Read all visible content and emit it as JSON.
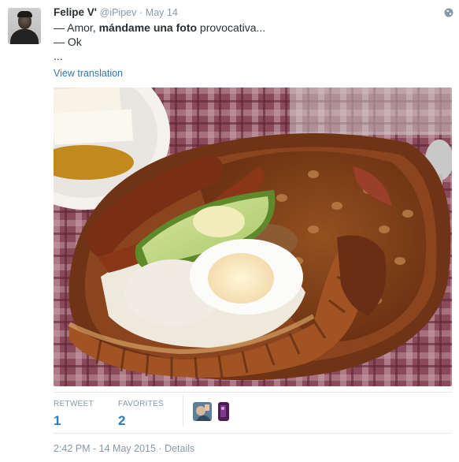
{
  "tweet": {
    "fullname": "Felipe V'",
    "handle": "@iPipev",
    "separator": "·",
    "date": "May 14",
    "line1_prefix": "— Amor, ",
    "line1_bold": "mándame una foto",
    "line1_suffix": " provocativa...",
    "line2": "— Ok",
    "line3": "...",
    "translate": "View translation"
  },
  "stats": {
    "retweet_label": "RETWEET",
    "retweet_count": "1",
    "favorites_label": "FAVORITES",
    "favorites_count": "2"
  },
  "footer": {
    "timestamp": "2:42 PM - 14 May 2015",
    "separator": "·",
    "details": "Details"
  },
  "photo_description": {
    "tablecloth": "#7a3b4a",
    "plate": "#7a3a1e",
    "beans": "#7b3d1b",
    "accent": "#2b7bb9",
    "muted": "#8899a6"
  },
  "icons": [
    "globe-icon",
    "avatar",
    "favoriter-avatar"
  ]
}
